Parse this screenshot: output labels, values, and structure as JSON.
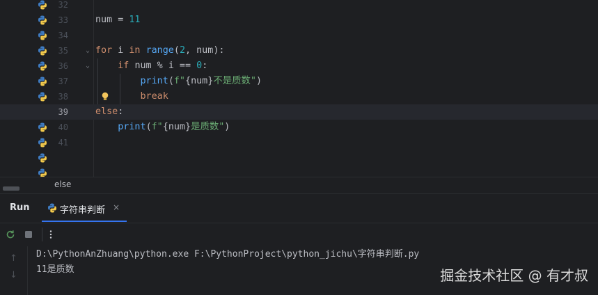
{
  "editor": {
    "lines": [
      {
        "num": "32",
        "code": ""
      },
      {
        "num": "33",
        "code": "num = 11"
      },
      {
        "num": "34",
        "code": ""
      },
      {
        "num": "35",
        "code": "for i in range(2, num):"
      },
      {
        "num": "36",
        "code": "    if num % i == 0:"
      },
      {
        "num": "37",
        "code": "        print(f\"{num}不是质数\")"
      },
      {
        "num": "38",
        "code": "        break"
      },
      {
        "num": "39",
        "code": "else:"
      },
      {
        "num": "40",
        "code": "    print(f\"{num}是质数\")"
      },
      {
        "num": "41",
        "code": ""
      }
    ],
    "current_line": "39",
    "bulb_icon": "lightbulb-icon",
    "file_icon": "python-file-icon"
  },
  "breadcrumb": {
    "item": "else"
  },
  "run": {
    "title": "Run",
    "tab_label": "字符串判断",
    "tab_close": "×",
    "toolbar": {
      "rerun_icon": "rerun-icon",
      "stop_icon": "stop-icon",
      "more_icon": "more-vertical-icon"
    },
    "console": {
      "command": "D:\\PythonAnZhuang\\python.exe F:\\PythonProject\\python_jichu\\字符串判断.py",
      "output": "11是质数"
    }
  },
  "watermark": "掘金技术社区 @ 有才叔",
  "colors": {
    "background": "#1e1f22",
    "keyword": "#cf8e6d",
    "function": "#56a8f5",
    "number": "#2aacb8",
    "string": "#6aab73",
    "accent": "#3574f0"
  }
}
